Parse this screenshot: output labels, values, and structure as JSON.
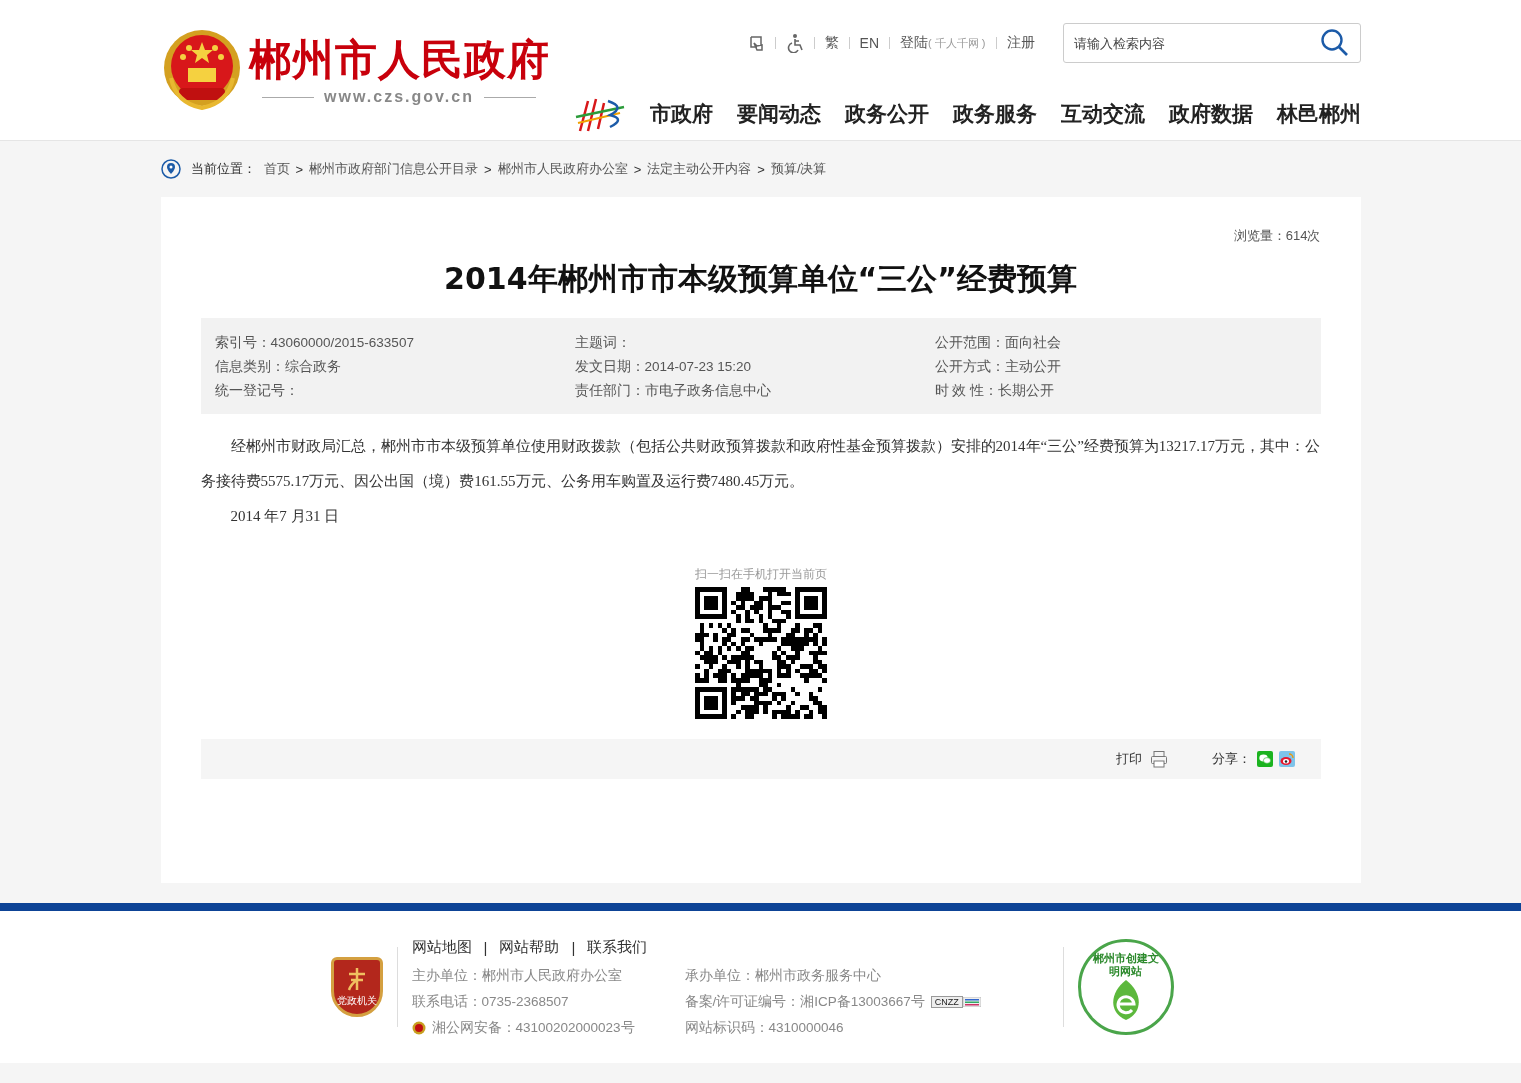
{
  "header": {
    "site_name": "郴州市人民政府",
    "site_url": "www.czs.gov.cn",
    "top_links": [
      {
        "kind": "hand_icon"
      },
      {
        "kind": "access_icon"
      },
      {
        "kind": "text",
        "label": "繁"
      },
      {
        "kind": "text",
        "label": "EN"
      },
      {
        "kind": "login",
        "label": "登陆",
        "note": "( 千人千网 )"
      },
      {
        "kind": "text",
        "label": "注册"
      }
    ],
    "search": {
      "placeholder": "请输入检索内容"
    },
    "nav": [
      "市政府",
      "要闻动态",
      "政务公开",
      "政务服务",
      "互动交流",
      "政府数据",
      "林邑郴州"
    ]
  },
  "breadcrumb": {
    "label": "当前位置：",
    "separator": ">",
    "items": [
      "首页",
      "郴州市政府部门信息公开目录",
      "郴州市人民政府办公室",
      "法定主动公开内容",
      "预算/决算"
    ]
  },
  "article": {
    "views": "浏览量：614次",
    "title": "2014年郴州市市本级预算单位“三公”经费预算",
    "meta": [
      "索引号：43060000/2015-633507",
      "主题词：",
      "公开范围：面向社会",
      "信息类别：综合政务",
      "发文日期：2014-07-23 15:20",
      "公开方式：主动公开",
      "统一登记号：",
      "责任部门：市电子政务信息中心",
      "时 效 性：长期公开"
    ],
    "paragraphs": [
      "经郴州市财政局汇总，郴州市市本级预算单位使用财政拨款（包括公共财政预算拨款和政府性基金预算拨款）安排的2014年“三公”经费预算为13217.17万元，其中：公务接待费5575.17万元、因公出国（境）费161.55万元、公务用车购置及运行费7480.45万元。",
      "2014 年7 月31 日"
    ],
    "qr_caption": "扫一扫在手机打开当前页",
    "print": "打印",
    "share": "分享："
  },
  "footer": {
    "links": [
      "网站地图",
      "网站帮助",
      "联系我们"
    ],
    "link_separator": "|",
    "badge_text": "党政机关",
    "info": [
      {
        "text": "主办单位：郴州市人民政府办公室"
      },
      {
        "text": "承办单位：郴州市政务服务中心"
      },
      {
        "text": "联系电话：0735-2368507"
      },
      {
        "text": "备案/许可证编号：湘ICP备13003667号",
        "counter": "CNZZ"
      },
      {
        "text": "湘公网安备：43100202000023号",
        "police": true
      },
      {
        "text": "网站标识码：4310000046"
      }
    ],
    "civil_badge": "郴州市创建文明网站"
  }
}
